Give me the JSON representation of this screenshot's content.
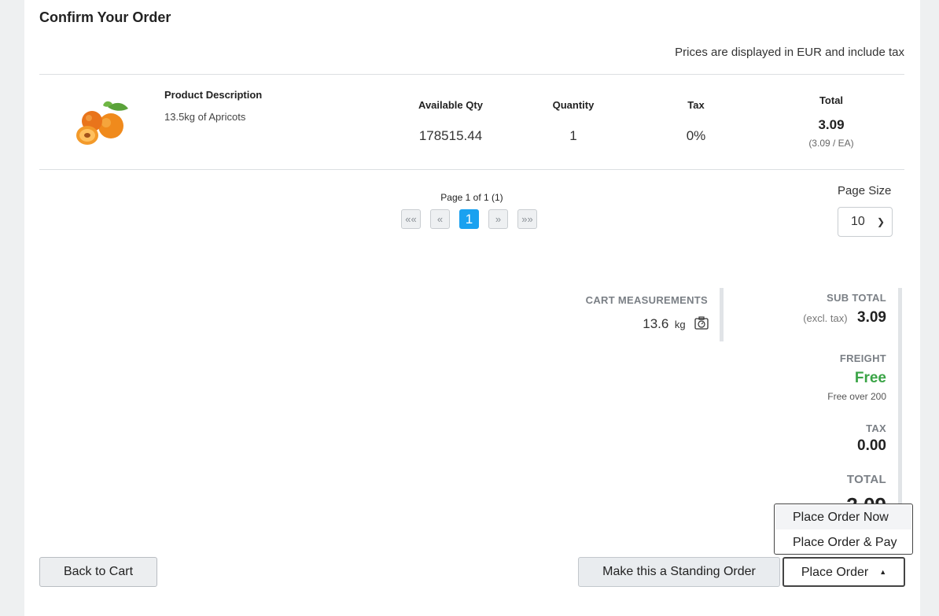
{
  "page": {
    "title": "Confirm Your Order",
    "price_note": "Prices are displayed in EUR and include tax"
  },
  "columns": {
    "description": "Product Description",
    "available_qty": "Available Qty",
    "quantity": "Quantity",
    "tax": "Tax",
    "total": "Total"
  },
  "items": [
    {
      "image": "apricots-image",
      "description": "13.5kg of Apricots",
      "available_qty": "178515.44",
      "quantity": "1",
      "tax": "0%",
      "total": "3.09",
      "unit_price": "(3.09 / EA)"
    }
  ],
  "pagination": {
    "status": "Page 1 of 1 (1)",
    "first": "««",
    "prev": "«",
    "current": "1",
    "next": "»",
    "last": "»»",
    "page_size_label": "Page Size",
    "page_size": "10"
  },
  "measurements": {
    "label": "CART MEASUREMENTS",
    "value": "13.6",
    "unit": "kg",
    "icon": "scale-icon"
  },
  "summary": {
    "subtotal_label": "SUB TOTAL",
    "subtotal_note": "(excl. tax)",
    "subtotal_value": "3.09",
    "freight_label": "FREIGHT",
    "freight_value": "Free",
    "freight_note": "Free over 200",
    "tax_label": "TAX",
    "tax_value": "0.00",
    "total_label": "TOTAL",
    "total_value": "3.09"
  },
  "actions": {
    "back": "Back to Cart",
    "standing": "Make this a Standing Order",
    "place": "Place Order",
    "menu": [
      "Place Order Now",
      "Place Order & Pay"
    ]
  },
  "colors": {
    "accent": "#1aa1f0",
    "free": "#3aa446"
  }
}
